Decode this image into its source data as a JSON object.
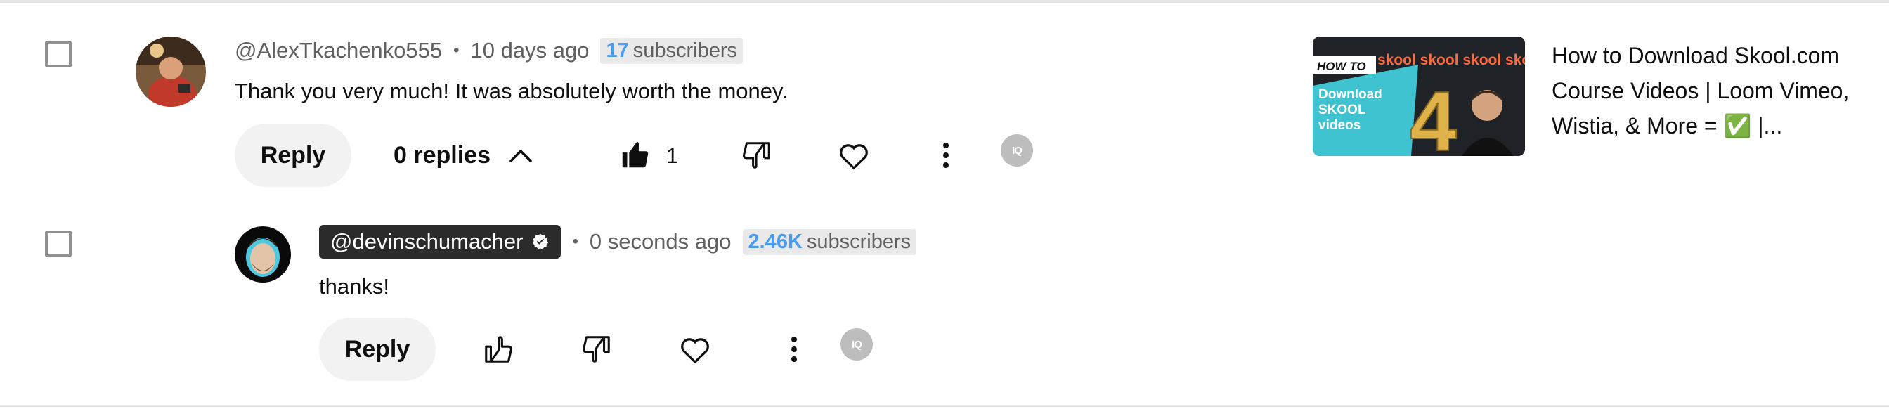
{
  "comments": [
    {
      "author": "@AlexTkachenko555",
      "time": "10 days ago",
      "subscribers_count": "17",
      "subscribers_label": "subscribers",
      "text": "Thank you very much! It was absolutely worth the money.",
      "reply_label": "Reply",
      "replies_label": "0 replies",
      "like_count": "1"
    },
    {
      "author": "@devinschumacher",
      "time": "0 seconds ago",
      "subscribers_count": "2.46K",
      "subscribers_label": "subscribers",
      "text": "thanks!",
      "reply_label": "Reply"
    }
  ],
  "separator": "•",
  "extension_badge": "IQ",
  "video": {
    "title": "How to Download Skool.com Course Videos | Loom Vimeo, Wistia, & More = ✅ |...",
    "thumb_text_howto": "HOW TO",
    "thumb_text_body": "Download SKOOL videos",
    "thumb_number": "4",
    "thumb_brand": "skool skool skool skoo"
  },
  "colors": {
    "subscriber_count_accent": "#4a9cf0",
    "owner_pill_bg": "#2b2b2b",
    "button_bg": "#f2f2f2"
  },
  "icons": [
    "thumbs-up-filled-icon",
    "thumbs-down-icon",
    "heart-icon",
    "more-vert-icon",
    "chevron-up-icon",
    "verified-icon",
    "extension-iq-icon"
  ]
}
